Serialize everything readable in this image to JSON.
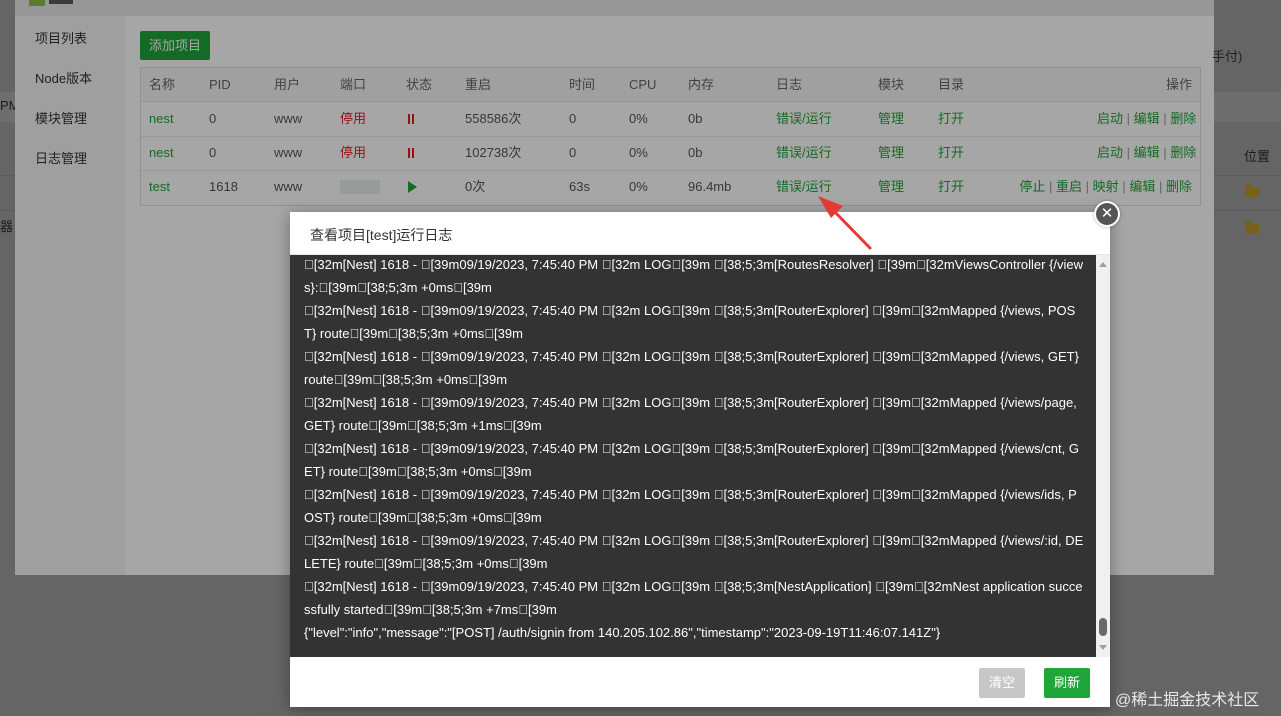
{
  "background": {
    "left_fragments": [
      "PM",
      "器"
    ],
    "right_header": "位置"
  },
  "sidebar": {
    "items": [
      "项目列表",
      "Node版本",
      "模块管理",
      "日志管理"
    ]
  },
  "toolbar": {
    "add_label": "添加项目",
    "hint": "手付)"
  },
  "table": {
    "headers": [
      "名称",
      "PID",
      "用户",
      "端口",
      "状态",
      "重启",
      "时间",
      "CPU",
      "内存",
      "日志",
      "模块",
      "目录",
      "操作"
    ],
    "rows": [
      {
        "name": "nest",
        "pid": "0",
        "user": "www",
        "port": "停用",
        "status": "paused",
        "restart": "558586次",
        "time": "0",
        "cpu": "0%",
        "mem": "0b",
        "log": "错误/运行",
        "module": "管理",
        "dir": "打开",
        "actions": [
          "启动",
          "编辑",
          "删除"
        ]
      },
      {
        "name": "nest",
        "pid": "0",
        "user": "www",
        "port": "停用",
        "status": "paused",
        "restart": "102738次",
        "time": "0",
        "cpu": "0%",
        "mem": "0b",
        "log": "错误/运行",
        "module": "管理",
        "dir": "打开",
        "actions": [
          "启动",
          "编辑",
          "删除"
        ]
      },
      {
        "name": "test",
        "pid": "1618",
        "user": "www",
        "port": "",
        "status": "running",
        "restart": "0次",
        "time": "63s",
        "cpu": "0%",
        "mem": "96.4mb",
        "log": "错误/运行",
        "module": "管理",
        "dir": "打开",
        "actions": [
          "停止",
          "重启",
          "映射",
          "编辑",
          "删除"
        ]
      }
    ],
    "action_separator": "|"
  },
  "modal": {
    "title": "查看项目[test]运行日志",
    "log_lines": [
      "\u0000[32m[Nest] 1618  - \u0000[39m09/19/2023, 7:45:40 PM \u0000[32m    LOG\u0000[39m \u0000[38;5;3m[RoutesResolver] \u0000[39m\u0000[32mViewsController {/views}:\u0000[39m\u0000[38;5;3m +0ms\u0000[39m",
      "\u0000[32m[Nest] 1618  - \u0000[39m09/19/2023, 7:45:40 PM \u0000[32m    LOG\u0000[39m \u0000[38;5;3m[RouterExplorer] \u0000[39m\u0000[32mMapped {/views, POST} route\u0000[39m\u0000[38;5;3m +0ms\u0000[39m",
      "\u0000[32m[Nest] 1618  - \u0000[39m09/19/2023, 7:45:40 PM \u0000[32m    LOG\u0000[39m \u0000[38;5;3m[RouterExplorer] \u0000[39m\u0000[32mMapped {/views, GET} route\u0000[39m\u0000[38;5;3m +0ms\u0000[39m",
      "\u0000[32m[Nest] 1618  - \u0000[39m09/19/2023, 7:45:40 PM \u0000[32m    LOG\u0000[39m \u0000[38;5;3m[RouterExplorer] \u0000[39m\u0000[32mMapped {/views/page, GET} route\u0000[39m\u0000[38;5;3m +1ms\u0000[39m",
      "\u0000[32m[Nest] 1618  - \u0000[39m09/19/2023, 7:45:40 PM \u0000[32m    LOG\u0000[39m \u0000[38;5;3m[RouterExplorer] \u0000[39m\u0000[32mMapped {/views/cnt, GET} route\u0000[39m\u0000[38;5;3m +0ms\u0000[39m",
      "\u0000[32m[Nest] 1618  - \u0000[39m09/19/2023, 7:45:40 PM \u0000[32m    LOG\u0000[39m \u0000[38;5;3m[RouterExplorer] \u0000[39m\u0000[32mMapped {/views/ids, POST} route\u0000[39m\u0000[38;5;3m +0ms\u0000[39m",
      "\u0000[32m[Nest] 1618  - \u0000[39m09/19/2023, 7:45:40 PM \u0000[32m    LOG\u0000[39m \u0000[38;5;3m[RouterExplorer] \u0000[39m\u0000[32mMapped {/views/:id, DELETE} route\u0000[39m\u0000[38;5;3m +0ms\u0000[39m",
      "\u0000[32m[Nest] 1618  - \u0000[39m09/19/2023, 7:45:40 PM \u0000[32m    LOG\u0000[39m \u0000[38;5;3m[NestApplication] \u0000[39m\u0000[32mNest application successfully started\u0000[39m\u0000[38;5;3m +7ms\u0000[39m",
      "{\"level\":\"info\",\"message\":\"[POST] /auth/signin from 140.205.102.86\",\"timestamp\":\"2023-09-19T11:46:07.141Z\"}"
    ],
    "clear_label": "清空",
    "refresh_label": "刷新",
    "close_glyph": "✕"
  },
  "watermark": "@稀土掘金技术社区",
  "colors": {
    "accent": "#20a53a",
    "danger": "#e02020",
    "log_bg": "#333333",
    "annotation": "#e53935"
  }
}
